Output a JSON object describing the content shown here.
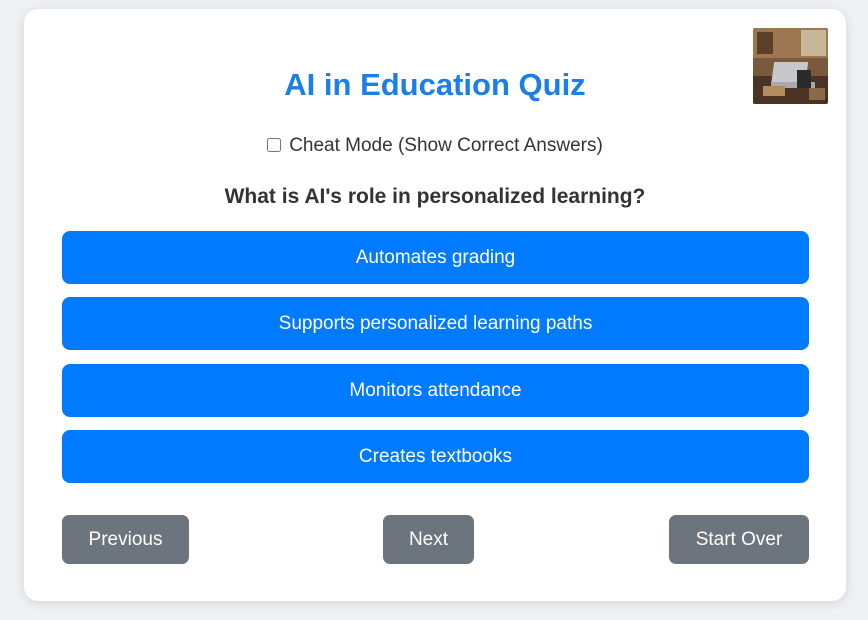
{
  "quiz": {
    "title": "AI in Education Quiz",
    "cheat_label": "Cheat Mode (Show Correct Answers)",
    "cheat_checked": false,
    "question": "What is AI's role in personalized learning?",
    "options": [
      "Automates grading",
      "Supports personalized learning paths",
      "Monitors attendance",
      "Creates textbooks"
    ],
    "nav": {
      "previous": "Previous",
      "next": "Next",
      "start_over": "Start Over"
    }
  },
  "colors": {
    "accent": "#1a7fe8",
    "option_bg": "#007bff",
    "nav_bg": "#6c757d",
    "page_bg": "#eef1f4"
  },
  "icons": {
    "thumbnail": "laptop-photo-thumbnail"
  }
}
